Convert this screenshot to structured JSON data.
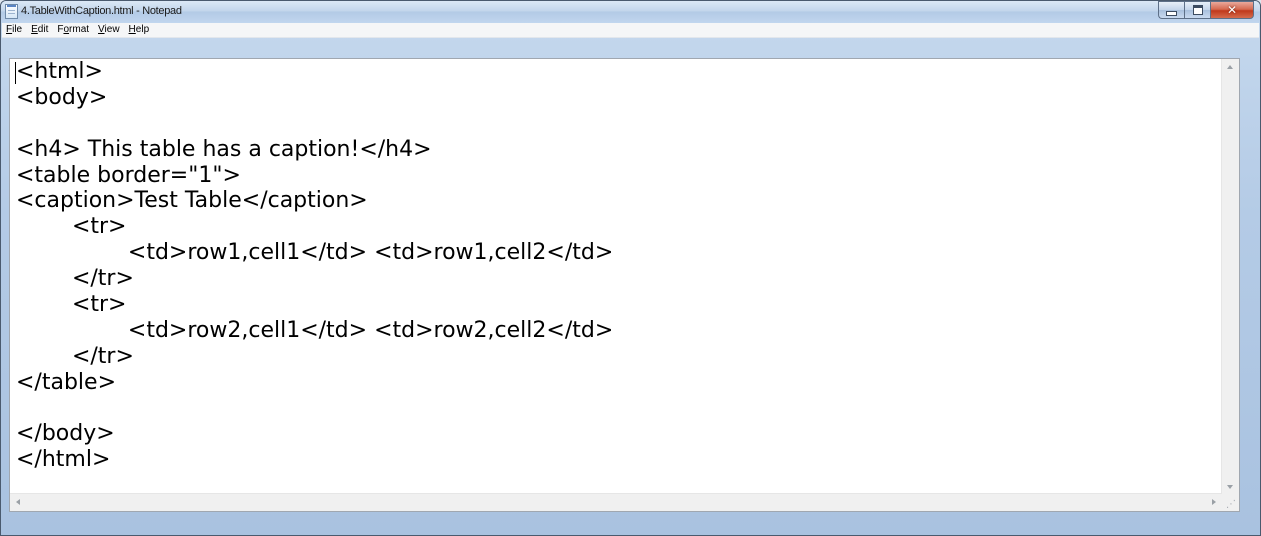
{
  "window": {
    "title": "4.TableWithCaption.html - Notepad",
    "frame_color": "#b4cbe6",
    "close_color": "#c0391c"
  },
  "menubar": {
    "file": {
      "mnemonic": "F",
      "rest": "ile"
    },
    "edit": {
      "mnemonic": "E",
      "rest": "dit"
    },
    "format": {
      "pre": "F",
      "mnemonic": "o",
      "rest": "rmat"
    },
    "view": {
      "mnemonic": "V",
      "rest": "iew"
    },
    "help": {
      "mnemonic": "H",
      "rest": "elp"
    }
  },
  "icons": {
    "app": "notepad-icon",
    "minimize": "minimize-icon",
    "maximize": "maximize-icon",
    "close": "close-icon",
    "scroll_up": "arrow-up-icon",
    "scroll_down": "arrow-down-icon",
    "scroll_left": "arrow-left-icon",
    "scroll_right": "arrow-right-icon",
    "size_grip": "resize-grip-icon"
  },
  "editor": {
    "lines": [
      "<html>",
      "<body>",
      "",
      "<h4> This table has a caption!</h4>",
      "<table border=\"1\">",
      "<caption>Test Table</caption>",
      "        <tr>",
      "                <td>row1,cell1</td> <td>row1,cell2</td>",
      "        </tr>",
      "        <tr>",
      "                <td>row2,cell1</td> <td>row2,cell2</td>",
      "        </tr>",
      "</table>",
      "",
      "</body>",
      "</html>"
    ]
  }
}
